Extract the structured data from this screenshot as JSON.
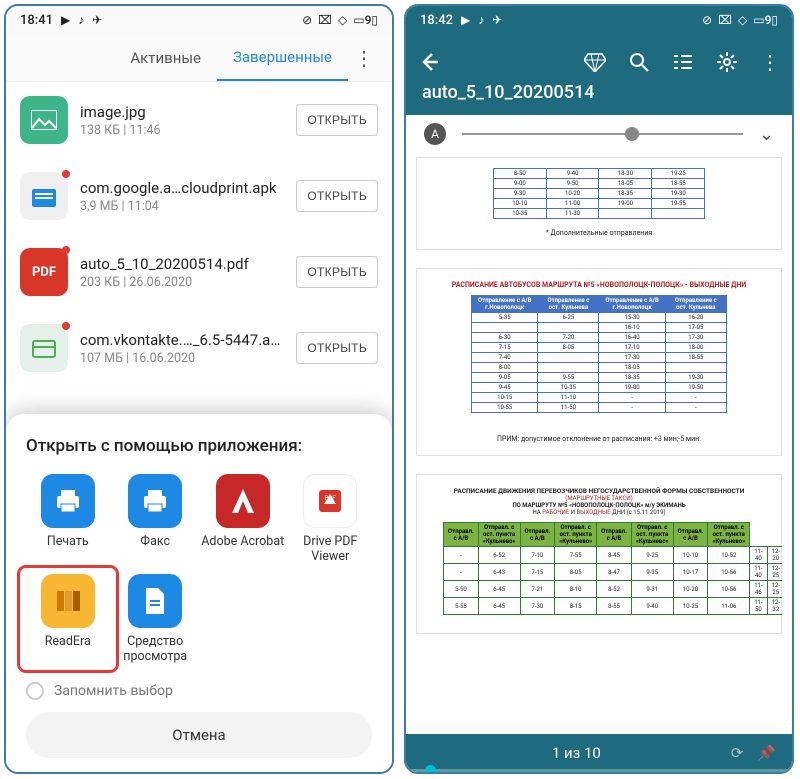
{
  "left": {
    "status": {
      "time": "18:41"
    },
    "tabs": {
      "active": "Активные",
      "completed": "Завершенные"
    },
    "open_label": "ОТКРЫТЬ",
    "files": [
      {
        "name": "image.jpg",
        "meta": "138 КБ | 11:46",
        "kind": "img"
      },
      {
        "name": "com.google.a…cloudprint.apk",
        "meta": "3,9 МБ | 11:04",
        "kind": "apk"
      },
      {
        "name": "auto_5_10_20200514.pdf",
        "meta": "203 КБ | 26.06.2020",
        "kind": "pdf"
      },
      {
        "name": "com.vkontakte.…_6.5-5447.apk",
        "meta": "107 МБ | 16.06.2020",
        "kind": "apk2"
      }
    ],
    "sheet": {
      "title": "Открыть с помощью приложения:",
      "apps": [
        {
          "label": "Печать",
          "icon": "print"
        },
        {
          "label": "Факс",
          "icon": "print"
        },
        {
          "label": "Adobe Acrobat",
          "icon": "adobe"
        },
        {
          "label": "Drive PDF Viewer",
          "icon": "drive"
        },
        {
          "label": "ReadEra",
          "icon": "readera",
          "highlighted": true
        },
        {
          "label": "Средство просмотра",
          "icon": "docs"
        }
      ],
      "remember": "Запомнить выбор",
      "cancel": "Отмена"
    }
  },
  "right": {
    "status": {
      "time": "18:42"
    },
    "title": "auto_5_10_20200514",
    "page_counter": "1 из 10",
    "doc": {
      "p1_footnote": "* Дополнительные отправления",
      "p2_title": "РАСПИСАНИЕ АВТОБУСОВ МАРШРУТА №5 «НОВОПОЛОЦК-ПОЛОЦК» - ",
      "p2_title_tail": "ВЫХОДНЫЕ ДНИ",
      "p2_foot": "ПРИМ: допустимое отклонение от расписания: +3 мин;-5 мин.",
      "p3_l1": "РАСПИСАНИЕ ДВИЖЕНИЯ ПЕРЕВОЗЧИКОВ НЕГОСУДАРСТВЕННОЙ ФОРМЫ СОБСТВЕННОСТИ",
      "p3_l2": "(МАРШРУТНЫЕ ТАКСИ)",
      "p3_l3": "ПО МАРШРУТУ №5 «НОВОПОЛОЦК-ПОЛОЦК» м/у ЭКИМАНЬ"
    }
  }
}
